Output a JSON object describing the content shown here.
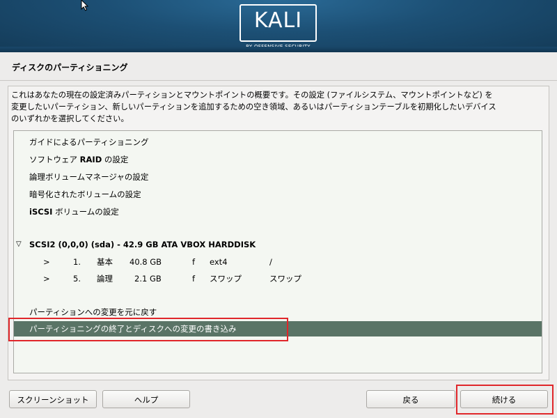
{
  "banner": {
    "logo_text": "KALI",
    "logo_subtext": "BY OFFENSIVE SECURITY",
    "background_color": "#1c4f74"
  },
  "page": {
    "title": "ディスクのパーティショニング"
  },
  "description": [
    "これはあなたの現在の設定済みパーティションとマウントポイントの概要です。その設定 (ファイルシステム、マウントポイントなど) を",
    "変更したいパーティション、新しいパーティションを追加するための空き領域、あるいはパーティションテーブルを初期化したいデバイス",
    "のいずれかを選択してください。"
  ],
  "menu": {
    "guided": "ガイドによるパーティショニング",
    "raid_prefix": "ソフトウェア ",
    "raid_bold": "RAID",
    "raid_suffix": " の設定",
    "lvm": "論理ボリュームマネージャの設定",
    "crypto": "暗号化されたボリュームの設定",
    "iscsi_bold": "iSCSI",
    "iscsi_suffix": " ボリュームの設定"
  },
  "disk": {
    "expander": "▽",
    "label": "SCSI2 (0,0,0) (sda) - 42.9 GB ATA VBOX HARDDISK",
    "partitions": [
      {
        "arrow": ">",
        "num": "1.",
        "type": "基本",
        "size": "40.8 GB",
        "flag": "f",
        "fs": "ext4",
        "mount": "/"
      },
      {
        "arrow": ">",
        "num": "5.",
        "type": "論理",
        "size": "2.1 GB",
        "flag": "f",
        "fs": "スワップ",
        "mount": "スワップ"
      }
    ]
  },
  "actions": {
    "undo": "パーティションへの変更を元に戻す",
    "finish": "パーティショニングの終了とディスクへの変更の書き込み"
  },
  "buttons": {
    "screenshot": "スクリーンショット",
    "help": "ヘルプ",
    "back": "戻る",
    "continue": "続ける"
  },
  "colors": {
    "selected_row": "#5a7466",
    "highlight_border": "#e0262a"
  }
}
